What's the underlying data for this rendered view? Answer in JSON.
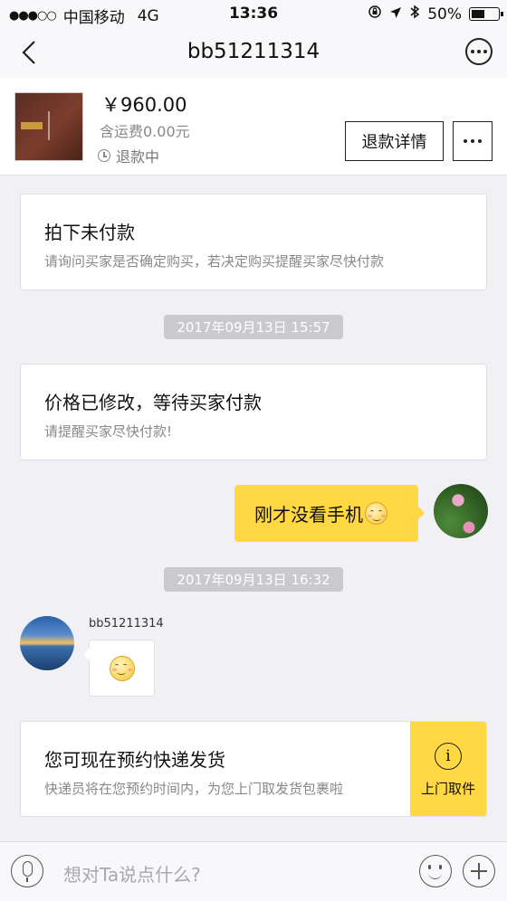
{
  "status_bar": {
    "signal": "●●●○○",
    "carrier": "中国移动",
    "network": "4G",
    "time": "13:36",
    "battery": "50%",
    "battery_level": 0.5
  },
  "nav": {
    "title": "bb51211314",
    "back_icon": "chevron-left-icon",
    "more_icon": "more-circle-icon"
  },
  "product": {
    "price": "￥960.00",
    "shipping": "含运费0.00元",
    "status": "退款中",
    "refund_button": "退款详情"
  },
  "cards": {
    "unpaid_title": "拍下未付款",
    "unpaid_text": "请询问买家是否确定购买，若决定购买提醒买家尽快付款",
    "modified_title": "价格已修改，等待买家付款",
    "modified_text": "请提醒买家尽快付款!"
  },
  "messages": {
    "time1": "2017年09月13日 15:57",
    "my_message": "刚才没看手机",
    "time2": "2017年09月13日 16:32",
    "sender_name": "bb51211314"
  },
  "pickup": {
    "title": "您可现在预约快递发货",
    "text": "快递员将在您预约时间内，为您上门取发货包裹啦",
    "button": "上门取件",
    "info_glyph": "i"
  },
  "input": {
    "placeholder": "想对Ta说点什么?"
  },
  "colors": {
    "accent": "#ffd844",
    "background": "#f1f1f5"
  }
}
